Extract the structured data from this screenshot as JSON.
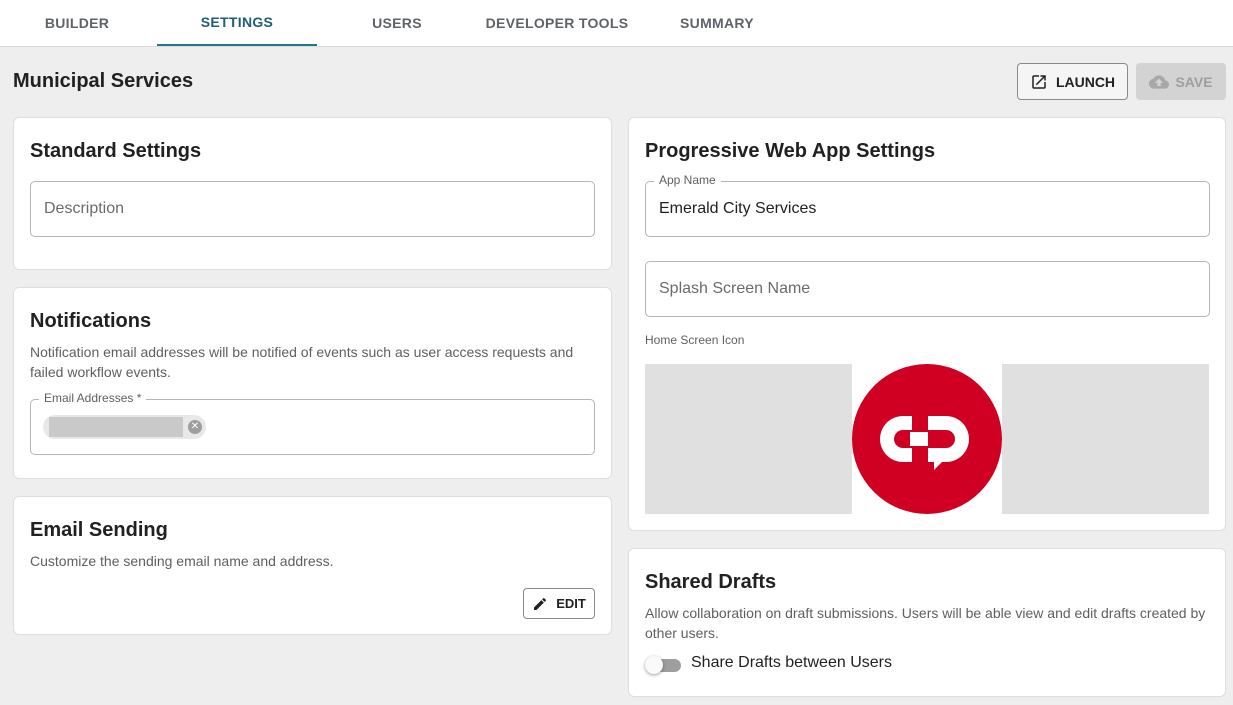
{
  "tabs": [
    {
      "label": "BUILDER",
      "active": false
    },
    {
      "label": "SETTINGS",
      "active": true
    },
    {
      "label": "USERS",
      "active": false
    },
    {
      "label": "DEVELOPER TOOLS",
      "active": false
    },
    {
      "label": "SUMMARY",
      "active": false
    }
  ],
  "header": {
    "title": "Municipal Services",
    "launch_label": "LAUNCH",
    "save_label": "SAVE"
  },
  "standard_settings": {
    "title": "Standard Settings",
    "description_placeholder": "Description"
  },
  "notifications": {
    "title": "Notifications",
    "text": "Notification email addresses will be notified of events such as user access requests and failed workflow events.",
    "email_label": "Email Addresses *"
  },
  "email_sending": {
    "title": "Email Sending",
    "text": "Customize the sending email name and address.",
    "edit_label": "EDIT"
  },
  "pwa": {
    "title": "Progressive Web App Settings",
    "app_name_label": "App Name",
    "app_name_value": "Emerald City Services",
    "splash_placeholder": "Splash Screen Name",
    "home_icon_label": "Home Screen Icon"
  },
  "shared_drafts": {
    "title": "Shared Drafts",
    "text": "Allow collaboration on draft submissions. Users will be able view and edit drafts created by other users.",
    "toggle_label": "Share Drafts between Users",
    "toggle_on": false
  },
  "colors": {
    "accent": "#1f7a8c",
    "logo_red": "#cf0022"
  }
}
